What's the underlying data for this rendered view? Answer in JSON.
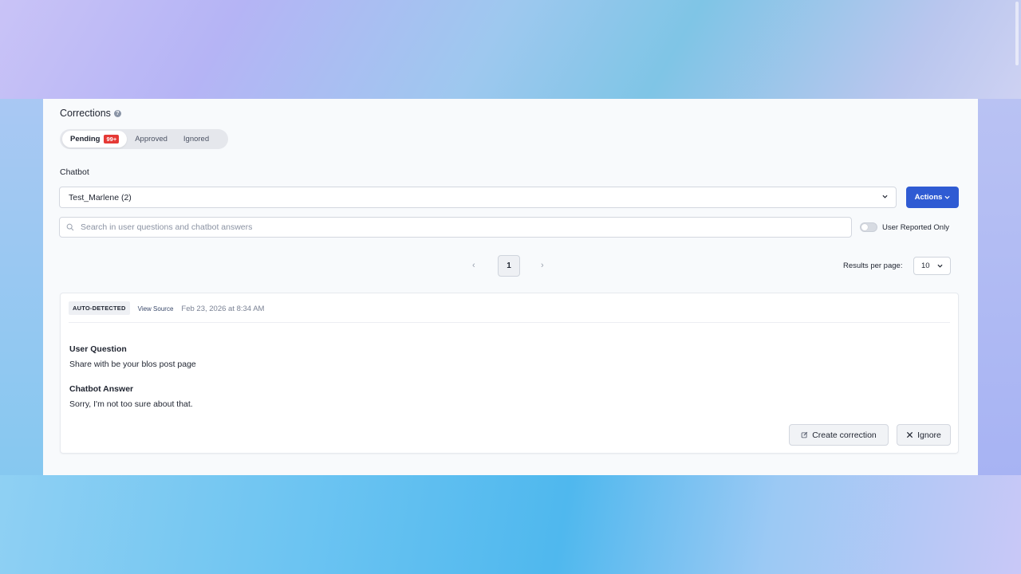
{
  "header": {
    "title": "Corrections"
  },
  "tabs": [
    {
      "label": "Pending",
      "badge": "99+",
      "active": true
    },
    {
      "label": "Approved",
      "active": false
    },
    {
      "label": "Ignored",
      "active": false
    }
  ],
  "chatbot": {
    "label": "Chatbot",
    "selected": "Test_Marlene (2)"
  },
  "actions": {
    "label": "Actions"
  },
  "search": {
    "placeholder": "Search in user questions and chatbot answers",
    "value": ""
  },
  "filter": {
    "user_reported_label": "User Reported Only",
    "user_reported_on": false
  },
  "pagination": {
    "current_page": "1",
    "results_per_page_label": "Results per page:",
    "results_per_page": "10"
  },
  "correction_item": {
    "badge": "AUTO-DETECTED",
    "view_source_label": "View Source",
    "date": "Feb 23, 2026 at 8:34 AM",
    "user_question_label": "User Question",
    "user_question": "Share with be your blos post page",
    "chatbot_answer_label": "Chatbot Answer",
    "chatbot_answer": "Sorry, I'm not too sure about that.",
    "create_label": "Create correction",
    "ignore_label": "Ignore"
  },
  "colors": {
    "accent": "#2f5bd3",
    "badge_red": "#e53935"
  }
}
